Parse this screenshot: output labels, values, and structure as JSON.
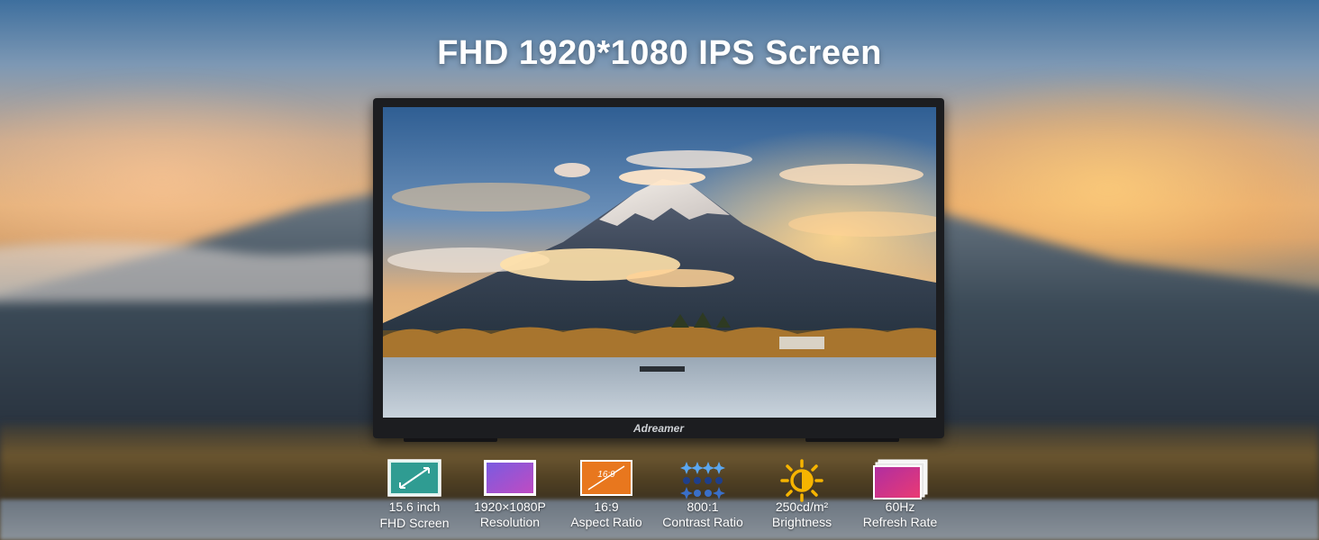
{
  "headline": "FHD 1920*1080 IPS Screen",
  "monitor": {
    "brand": "Adreamer"
  },
  "features": [
    {
      "icon": "screen-size-icon",
      "value": "15.6 inch",
      "label": "FHD Screen"
    },
    {
      "icon": "resolution-icon",
      "value": "1920×1080P",
      "label": "Resolution"
    },
    {
      "icon": "aspect-ratio-icon",
      "icon_text": "16:9",
      "value": "16:9",
      "label": "Aspect Ratio"
    },
    {
      "icon": "contrast-dots-icon",
      "value": "800:1",
      "label": "Contrast Ratio"
    },
    {
      "icon": "sun-icon",
      "value": "250cd/m²",
      "label": "Brightness"
    },
    {
      "icon": "refresh-rate-icon",
      "value": "60Hz",
      "label": "Refresh Rate"
    }
  ],
  "colors": {
    "sun": "#f6b400",
    "aspect": "#e8771e",
    "resolution": "#a24cd6",
    "refresh": "#c42c86",
    "screen_size": "#2f9c92",
    "contrast": "#3a6fc8"
  }
}
